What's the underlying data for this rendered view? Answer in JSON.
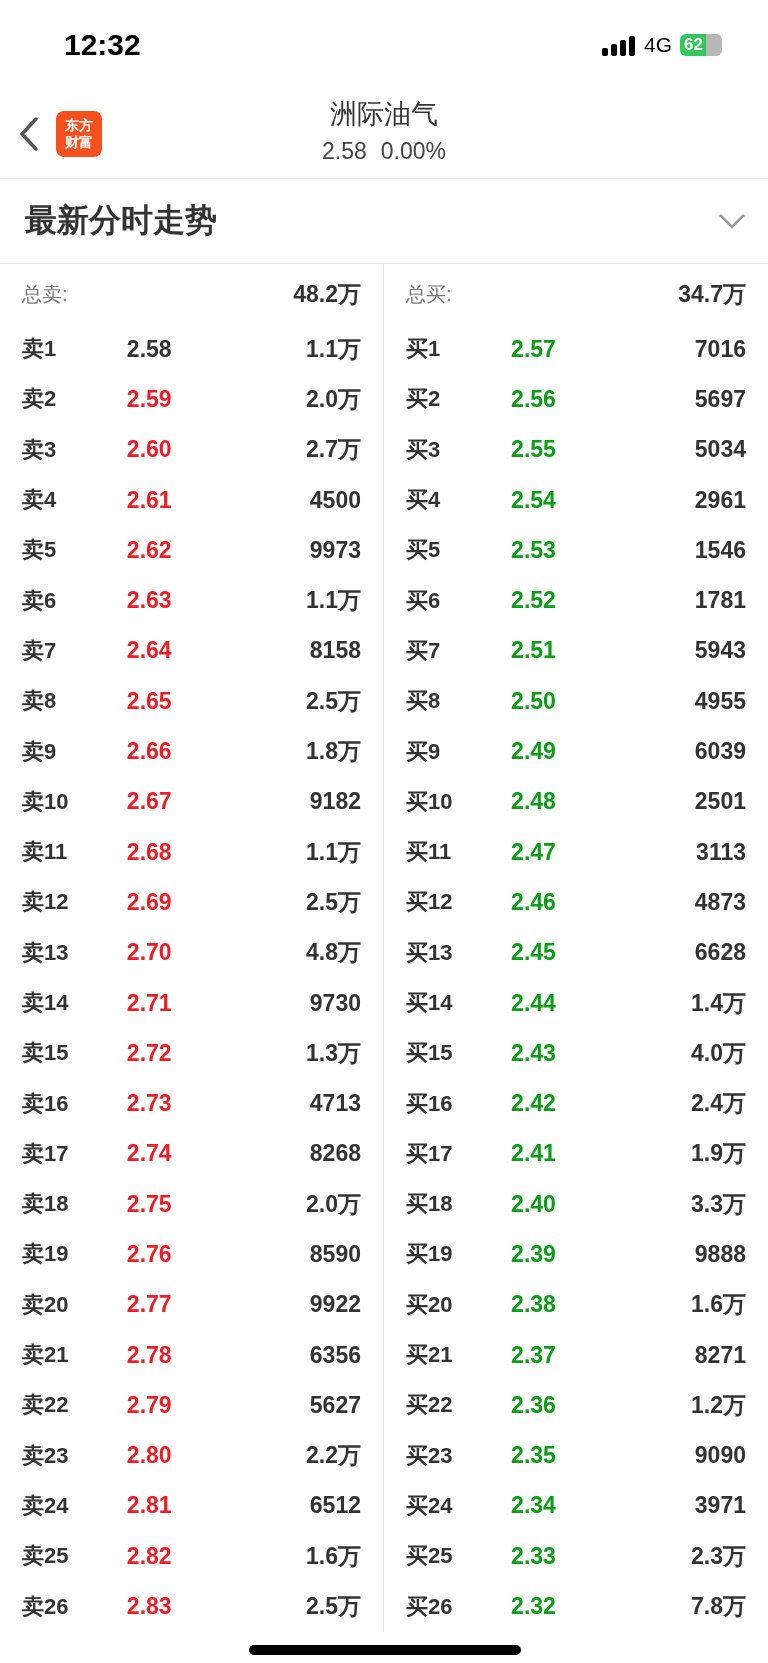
{
  "status_bar": {
    "time": "12:32",
    "network": "4G",
    "battery": "62"
  },
  "nav": {
    "title": "洲际油气",
    "price": "2.58",
    "change": "0.00%",
    "logo_lines": [
      "东方",
      "财富"
    ]
  },
  "section": {
    "title": "最新分时走势",
    "expanded": false
  },
  "book": [
    {
      "total_label": "总卖:",
      "total": "48.2万",
      "rows": [
        {
          "label": "卖1",
          "price": "2.58",
          "color": "#333333",
          "volume": "1.1万"
        },
        {
          "label": "卖2",
          "price": "2.59",
          "color": "#ee1c25",
          "volume": "2.0万"
        },
        {
          "label": "卖3",
          "price": "2.60",
          "color": "#ee1c25",
          "volume": "2.7万"
        },
        {
          "label": "卖4",
          "price": "2.61",
          "color": "#ee1c25",
          "volume": "4500"
        },
        {
          "label": "卖5",
          "price": "2.62",
          "color": "#ee1c25",
          "volume": "9973"
        },
        {
          "label": "卖6",
          "price": "2.63",
          "color": "#ee1c25",
          "volume": "1.1万"
        },
        {
          "label": "卖7",
          "price": "2.64",
          "color": "#ee1c25",
          "volume": "8158"
        },
        {
          "label": "卖8",
          "price": "2.65",
          "color": "#ee1c25",
          "volume": "2.5万"
        },
        {
          "label": "卖9",
          "price": "2.66",
          "color": "#ee1c25",
          "volume": "1.8万"
        },
        {
          "label": "卖10",
          "price": "2.67",
          "color": "#ee1c25",
          "volume": "9182"
        },
        {
          "label": "卖11",
          "price": "2.68",
          "color": "#ee1c25",
          "volume": "1.1万"
        },
        {
          "label": "卖12",
          "price": "2.69",
          "color": "#ee1c25",
          "volume": "2.5万"
        },
        {
          "label": "卖13",
          "price": "2.70",
          "color": "#ee1c25",
          "volume": "4.8万"
        },
        {
          "label": "卖14",
          "price": "2.71",
          "color": "#ee1c25",
          "volume": "9730"
        },
        {
          "label": "卖15",
          "price": "2.72",
          "color": "#ee1c25",
          "volume": "1.3万"
        },
        {
          "label": "卖16",
          "price": "2.73",
          "color": "#ee1c25",
          "volume": "4713"
        },
        {
          "label": "卖17",
          "price": "2.74",
          "color": "#ee1c25",
          "volume": "8268"
        },
        {
          "label": "卖18",
          "price": "2.75",
          "color": "#ee1c25",
          "volume": "2.0万"
        },
        {
          "label": "卖19",
          "price": "2.76",
          "color": "#ee1c25",
          "volume": "8590"
        },
        {
          "label": "卖20",
          "price": "2.77",
          "color": "#ee1c25",
          "volume": "9922"
        },
        {
          "label": "卖21",
          "price": "2.78",
          "color": "#ee1c25",
          "volume": "6356"
        },
        {
          "label": "卖22",
          "price": "2.79",
          "color": "#ee1c25",
          "volume": "5627"
        },
        {
          "label": "卖23",
          "price": "2.80",
          "color": "#ee1c25",
          "volume": "2.2万"
        },
        {
          "label": "卖24",
          "price": "2.81",
          "color": "#ee1c25",
          "volume": "6512"
        },
        {
          "label": "卖25",
          "price": "2.82",
          "color": "#ee1c25",
          "volume": "1.6万"
        },
        {
          "label": "卖26",
          "price": "2.83",
          "color": "#ee1c25",
          "volume": "2.5万"
        }
      ]
    },
    {
      "total_label": "总买:",
      "total": "34.7万",
      "rows": [
        {
          "label": "买1",
          "price": "2.57",
          "color": "#0a9e16",
          "volume": "7016"
        },
        {
          "label": "买2",
          "price": "2.56",
          "color": "#0a9e16",
          "volume": "5697"
        },
        {
          "label": "买3",
          "price": "2.55",
          "color": "#0a9e16",
          "volume": "5034"
        },
        {
          "label": "买4",
          "price": "2.54",
          "color": "#0a9e16",
          "volume": "2961"
        },
        {
          "label": "买5",
          "price": "2.53",
          "color": "#0a9e16",
          "volume": "1546"
        },
        {
          "label": "买6",
          "price": "2.52",
          "color": "#0a9e16",
          "volume": "1781"
        },
        {
          "label": "买7",
          "price": "2.51",
          "color": "#0a9e16",
          "volume": "5943"
        },
        {
          "label": "买8",
          "price": "2.50",
          "color": "#0a9e16",
          "volume": "4955"
        },
        {
          "label": "买9",
          "price": "2.49",
          "color": "#0a9e16",
          "volume": "6039"
        },
        {
          "label": "买10",
          "price": "2.48",
          "color": "#0a9e16",
          "volume": "2501"
        },
        {
          "label": "买11",
          "price": "2.47",
          "color": "#0a9e16",
          "volume": "3113"
        },
        {
          "label": "买12",
          "price": "2.46",
          "color": "#0a9e16",
          "volume": "4873"
        },
        {
          "label": "买13",
          "price": "2.45",
          "color": "#0a9e16",
          "volume": "6628"
        },
        {
          "label": "买14",
          "price": "2.44",
          "color": "#0a9e16",
          "volume": "1.4万"
        },
        {
          "label": "买15",
          "price": "2.43",
          "color": "#0a9e16",
          "volume": "4.0万"
        },
        {
          "label": "买16",
          "price": "2.42",
          "color": "#0a9e16",
          "volume": "2.4万"
        },
        {
          "label": "买17",
          "price": "2.41",
          "color": "#0a9e16",
          "volume": "1.9万"
        },
        {
          "label": "买18",
          "price": "2.40",
          "color": "#0a9e16",
          "volume": "3.3万"
        },
        {
          "label": "买19",
          "price": "2.39",
          "color": "#0a9e16",
          "volume": "9888"
        },
        {
          "label": "买20",
          "price": "2.38",
          "color": "#0a9e16",
          "volume": "1.6万"
        },
        {
          "label": "买21",
          "price": "2.37",
          "color": "#0a9e16",
          "volume": "8271"
        },
        {
          "label": "买22",
          "price": "2.36",
          "color": "#0a9e16",
          "volume": "1.2万"
        },
        {
          "label": "买23",
          "price": "2.35",
          "color": "#0a9e16",
          "volume": "9090"
        },
        {
          "label": "买24",
          "price": "2.34",
          "color": "#0a9e16",
          "volume": "3971"
        },
        {
          "label": "买25",
          "price": "2.33",
          "color": "#0a9e16",
          "volume": "2.3万"
        },
        {
          "label": "买26",
          "price": "2.32",
          "color": "#0a9e16",
          "volume": "7.8万"
        }
      ]
    }
  ]
}
